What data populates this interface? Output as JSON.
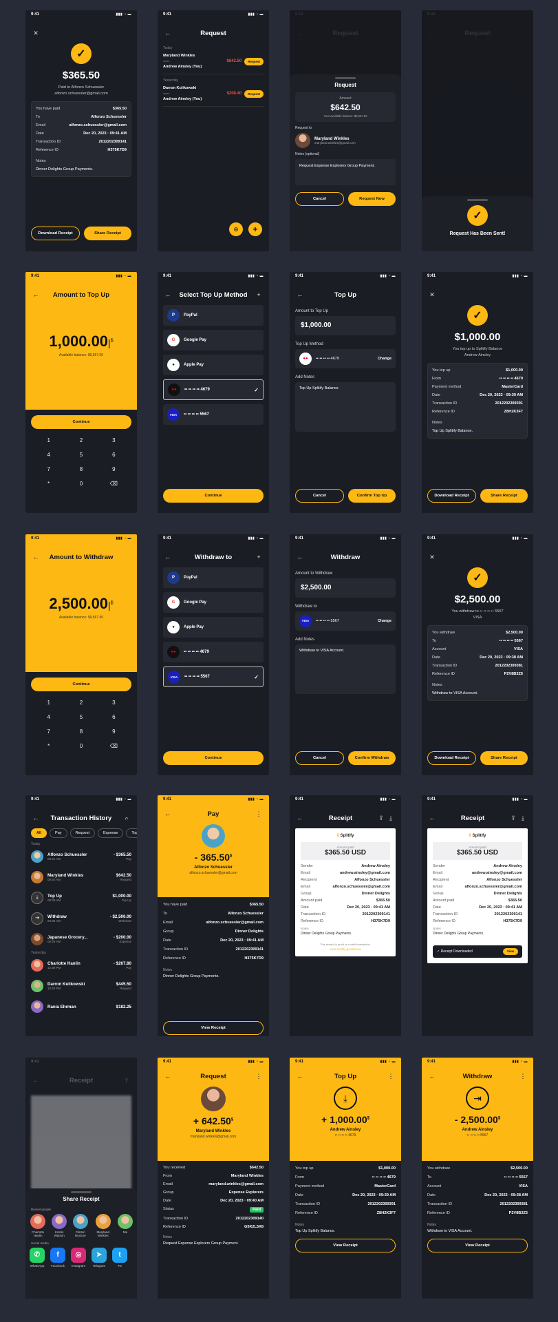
{
  "status_time": "9:41",
  "signal": "▮▮▮ ◔ ▬",
  "paid": {
    "amount": "$365.50",
    "to_line": "Paid to Alfonzo Schuessler",
    "email": "alfonzo.schuessler@gmail.com",
    "rows": [
      [
        "You have paid",
        "$365.50"
      ],
      [
        "To",
        "Alfonzo Schuessler"
      ],
      [
        "Email",
        "alfonzo.schuessler@gmail.com"
      ],
      [
        "Date",
        "Dec 20, 2023 · 09:41 AM"
      ],
      [
        "Transaction ID",
        "2012202309141"
      ],
      [
        "Reference ID",
        "H375K7D9"
      ]
    ],
    "notes_label": "Notes",
    "notes": "Dinner Delights Group Payments.",
    "btn_download": "Download Receipt",
    "btn_share": "Share Receipt"
  },
  "request_list": {
    "title": "Request",
    "today": "Today",
    "yesterday": "Yesterday",
    "items": [
      {
        "name": "Maryland Winkles",
        "mid": "owes",
        "you": "Andrew Ainsley (You)",
        "amount": "$642.50",
        "action": "Request"
      },
      {
        "name": "Darron Kulikowski",
        "mid": "owes",
        "you": "Andrew Ainsley (You)",
        "amount": "$208.40",
        "action": "Request"
      }
    ]
  },
  "request_sheet": {
    "title": "Request",
    "amount_label": "Amount",
    "amount": "$642.50",
    "balance": "Your available balance: $9,567.50",
    "to_label": "Request to",
    "name": "Maryland Winkles",
    "email": "maryland.winkles@gmail.com",
    "notes_label": "Notes (optional)",
    "notes": "Request Expense Explorers Group Payment.",
    "cancel": "Cancel",
    "confirm": "Request Now"
  },
  "request_sent": {
    "msg": "Request Has Been Sent!"
  },
  "topup_amount": {
    "title": "Amount to Top Up",
    "amount": "1,000.00",
    "currency": "$",
    "balance": "Available balance: $9,567.50",
    "btn": "Continue",
    "keys": [
      "1",
      "2",
      "3",
      "4",
      "5",
      "6",
      "7",
      "8",
      "9",
      "*",
      "0",
      "⌫"
    ]
  },
  "topup_method": {
    "title": "Select Top Up Method",
    "methods": [
      "PayPal",
      "Google Pay",
      "Apple Pay",
      "•• •• •• •• 4679",
      "•• •• •• •• 5567"
    ],
    "btn": "Continue"
  },
  "topup": {
    "title": "Top Up",
    "amount_label": "Amount to Top Up",
    "amount": "$1,000.00",
    "method_label": "Top Up Method",
    "card": "•• •• •• •• 4679",
    "change": "Change",
    "notes_label": "Add Notes",
    "notes": "Top Up Splitify Balance.",
    "cancel": "Cancel",
    "confirm": "Confirm Top Up"
  },
  "topup_done": {
    "amount": "$1,000.00",
    "line1": "You top up to Splitify Balance",
    "line2": "Andrew Ainsley",
    "rows": [
      [
        "You top up",
        "$1,000.00"
      ],
      [
        "From",
        "•• •• •• •• 4679"
      ],
      [
        "Payment method",
        "MasterCard"
      ],
      [
        "Date",
        "Dec 20, 2023 · 09:39 AM"
      ],
      [
        "Transaction ID",
        "2012202309391"
      ],
      [
        "Reference ID",
        "Z8H2K3F7"
      ]
    ],
    "notes_label": "Notes",
    "notes": "Top Up Splitify Balance.",
    "btn_download": "Download Receipt",
    "btn_share": "Share Receipt"
  },
  "wd_amount": {
    "title": "Amount to Withdraw",
    "amount": "2,500.00",
    "currency": "$",
    "balance": "Available balance: $9,567.50",
    "btn": "Continue"
  },
  "wd_method": {
    "title": "Withdraw to",
    "btn": "Continue"
  },
  "withdraw": {
    "title": "Withdraw",
    "amount_label": "Amount to Withdraw",
    "amount": "$2,500.00",
    "method_label": "Withdraw to",
    "card": "•• •• •• •• 5567",
    "change": "Change",
    "notes_label": "Add Notes",
    "notes": "Withdraw to VISA Account.",
    "cancel": "Cancel",
    "confirm": "Confirm Withdraw"
  },
  "wd_done": {
    "amount": "$2,500.00",
    "line1": "You withdraw to •• •• •• •• 5567",
    "line2": "VISA",
    "rows": [
      [
        "You withdraw",
        "$2,500.00"
      ],
      [
        "To",
        "•• •• •• •• 5567"
      ],
      [
        "Account",
        "VISA"
      ],
      [
        "Date",
        "Dec 20, 2023 · 09:38 AM"
      ],
      [
        "Transaction ID",
        "2012202309381"
      ],
      [
        "Reference ID",
        "P2V8B3Z5"
      ]
    ],
    "notes_label": "Notes",
    "notes": "Withdraw to VISA Account.",
    "btn_download": "Download Receipt",
    "btn_share": "Share Receipt"
  },
  "history": {
    "title": "Transaction History",
    "chips": [
      "All",
      "Pay",
      "Request",
      "Expense",
      "Top"
    ],
    "today": "Today",
    "yesterday": "Yesterday",
    "items": [
      [
        "Alfonzo Schuessler",
        "09:41 AM",
        "- $365.50",
        "Pay"
      ],
      [
        "Maryland Winkles",
        "09:40 AM",
        "$642.50",
        "Request"
      ],
      [
        "Top Up",
        "09:39 AM",
        "$1,000.00",
        "Top Up"
      ],
      [
        "Withdraw",
        "09:38 AM",
        "- $2,500.00",
        "Withdraw"
      ],
      [
        "Japanese Grocery...",
        "09:36 AM",
        "- $200.00",
        "Expense"
      ]
    ],
    "items2": [
      [
        "Charlotte Hanlin",
        "12:38 PM",
        "- $267.80",
        "Pay"
      ],
      [
        "Darron Kulikowski",
        "10:40 PM",
        "$445.50",
        "Request"
      ],
      [
        "Rania Ehrman",
        "",
        "$182.25",
        ""
      ]
    ]
  },
  "pay_detail": {
    "title": "Pay",
    "amount": "- 365.50",
    "currency": "$",
    "name": "Alfonzo Schuessler",
    "email": "alfonzo.schuessler@gmail.com",
    "rows": [
      [
        "You have paid",
        "$365.50"
      ],
      [
        "To",
        "Alfonzo Schuessler"
      ],
      [
        "Email",
        "alfonzo.schuessler@gmail.com"
      ],
      [
        "Group",
        "Dinner Delights"
      ],
      [
        "Date",
        "Dec 20, 2023 · 09:41 AM"
      ],
      [
        "Transaction ID",
        "2012202309141"
      ],
      [
        "Reference ID",
        "H375K7D9"
      ]
    ],
    "notes_label": "Notes",
    "notes": "Dinner Delights Group Payments.",
    "btn": "View Receipt"
  },
  "receipt": {
    "title": "Receipt",
    "brand": "Splitify",
    "amount_label": "Amount paid",
    "amount": "$365.50 USD",
    "rows": [
      [
        "Sender",
        "Andrew Ainsley"
      ],
      [
        "Email",
        "andrew.ainsley@gmail.com"
      ],
      [
        "Recipient",
        "Alfonzo Schuessler"
      ],
      [
        "Email",
        "alfonzo.schuessler@gmail.com"
      ],
      [
        "Group",
        "Dinner Delights"
      ],
      [
        "Amount paid",
        "$365.50"
      ],
      [
        "Date",
        "Dec 20, 2023 · 09:41 AM"
      ],
      [
        "Transaction ID",
        "2012202309141"
      ],
      [
        "Reference ID",
        "H375K7D9"
      ]
    ],
    "notes_label": "Notes",
    "notes": "Dinner Delights Group Payments.",
    "proof": "This receipt is proof of a valid transaction.",
    "link": "www.splitify.goodarrow",
    "toast": "Receipt Downloaded",
    "toast_btn": "View"
  },
  "share": {
    "title": "Share Receipt",
    "recent": "Recent people",
    "social_label": "Social media",
    "people": [
      "Charlotte Hanlin",
      "Kristin Watson",
      "Clinton Mcclure",
      "Maryland Winkles",
      "Ma"
    ],
    "social": [
      "WhatsApp",
      "Facebook",
      "Instagram",
      "Telegram",
      "Tw"
    ]
  },
  "req_detail": {
    "title": "Request",
    "amount": "+ 642.50",
    "currency": "$",
    "name": "Maryland Winkles",
    "email": "maryland.winkles@gmail.com",
    "rows": [
      [
        "You received",
        "$642.50"
      ],
      [
        "From",
        "Maryland Winkles"
      ],
      [
        "Email",
        "maryland.winkles@gmail.com"
      ],
      [
        "Group",
        "Expense Explorers"
      ],
      [
        "Date",
        "Dec 20, 2023 · 09:40 AM"
      ],
      [
        "Status",
        "Paid"
      ],
      [
        "Transaction ID",
        "2012202309140"
      ],
      [
        "Reference ID",
        "G5K2L5X8"
      ]
    ],
    "notes_label": "Notes",
    "notes": "Request Expense Explorers Group Payment."
  },
  "topup_detail": {
    "title": "Top Up",
    "amount": "+ 1,000.00",
    "currency": "$",
    "name": "Andrew Ainsley",
    "card": "•• •• •• •• 4679",
    "rows": [
      [
        "You top up",
        "$1,000.00"
      ],
      [
        "From",
        "•• •• •• •• 4679"
      ],
      [
        "Payment method",
        "MasterCard"
      ],
      [
        "Date",
        "Dec 20, 2023 · 09:39 AM"
      ],
      [
        "Transaction ID",
        "2012202309391"
      ],
      [
        "Reference ID",
        "Z8H2K3F7"
      ]
    ],
    "notes_label": "Notes",
    "notes": "Top Up Splitify Balance.",
    "btn": "View Receipt"
  },
  "wd_detail": {
    "title": "Withdraw",
    "amount": "- 2,500.00",
    "currency": "$",
    "name": "Andrew Ainsley",
    "card": "•• •• •• •• 5567",
    "rows": [
      [
        "You withdraw",
        "$2,500.00"
      ],
      [
        "To",
        "•• •• •• •• 5567"
      ],
      [
        "Account",
        "VISA"
      ],
      [
        "Date",
        "Dec 20, 2023 · 09:38 AM"
      ],
      [
        "Transaction ID",
        "2012202309381"
      ],
      [
        "Reference ID",
        "P2V8B3Z5"
      ]
    ],
    "notes_label": "Notes",
    "notes": "Withdraw to VISA Account.",
    "btn": "View Receipt"
  },
  "colors": {
    "accent": "#fdb813",
    "bg": "#1b1d24",
    "card": "#262932",
    "red": "#e6533c",
    "green": "#22c55e"
  }
}
